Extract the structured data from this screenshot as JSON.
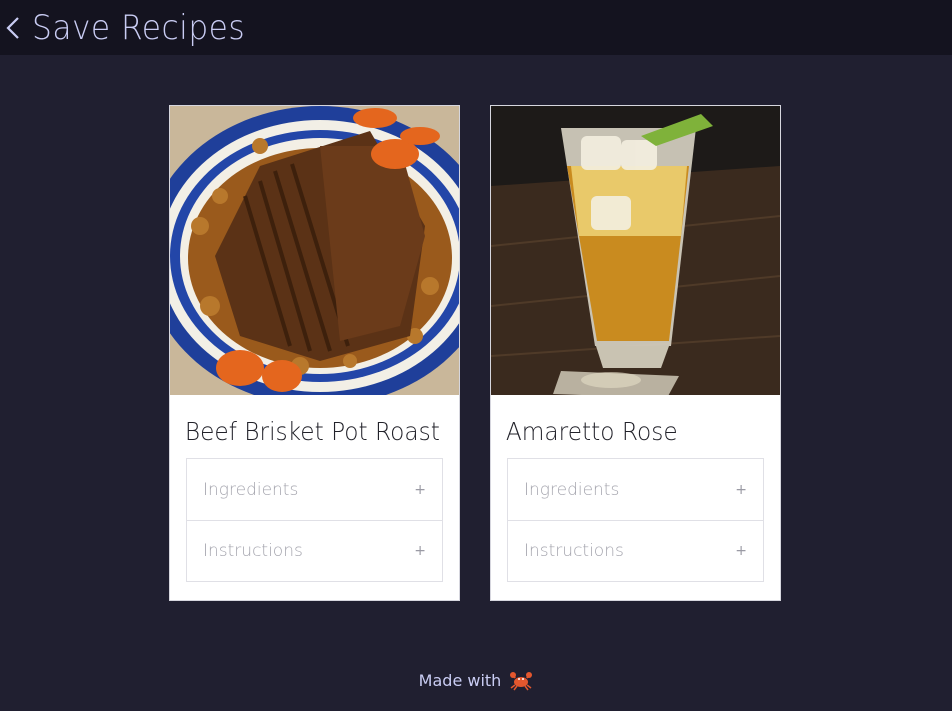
{
  "header": {
    "title": "Save Recipes",
    "back_icon": "chevron-left-icon"
  },
  "recipes": [
    {
      "title": "Beef Brisket Pot Roast",
      "image": "beef-brisket-photo",
      "sections": [
        {
          "label": "Ingredients",
          "toggle": "+"
        },
        {
          "label": "Instructions",
          "toggle": "+"
        }
      ]
    },
    {
      "title": "Amaretto Rose",
      "image": "amaretto-rose-photo",
      "sections": [
        {
          "label": "Ingredients",
          "toggle": "+"
        },
        {
          "label": "Instructions",
          "toggle": "+"
        }
      ]
    }
  ],
  "footer": {
    "text": "Made with",
    "icon": "crab-icon"
  },
  "colors": {
    "background": "#201f30",
    "header_bg": "#14131f",
    "accent_text": "#c9ccf3",
    "card_bg": "#ffffff"
  }
}
